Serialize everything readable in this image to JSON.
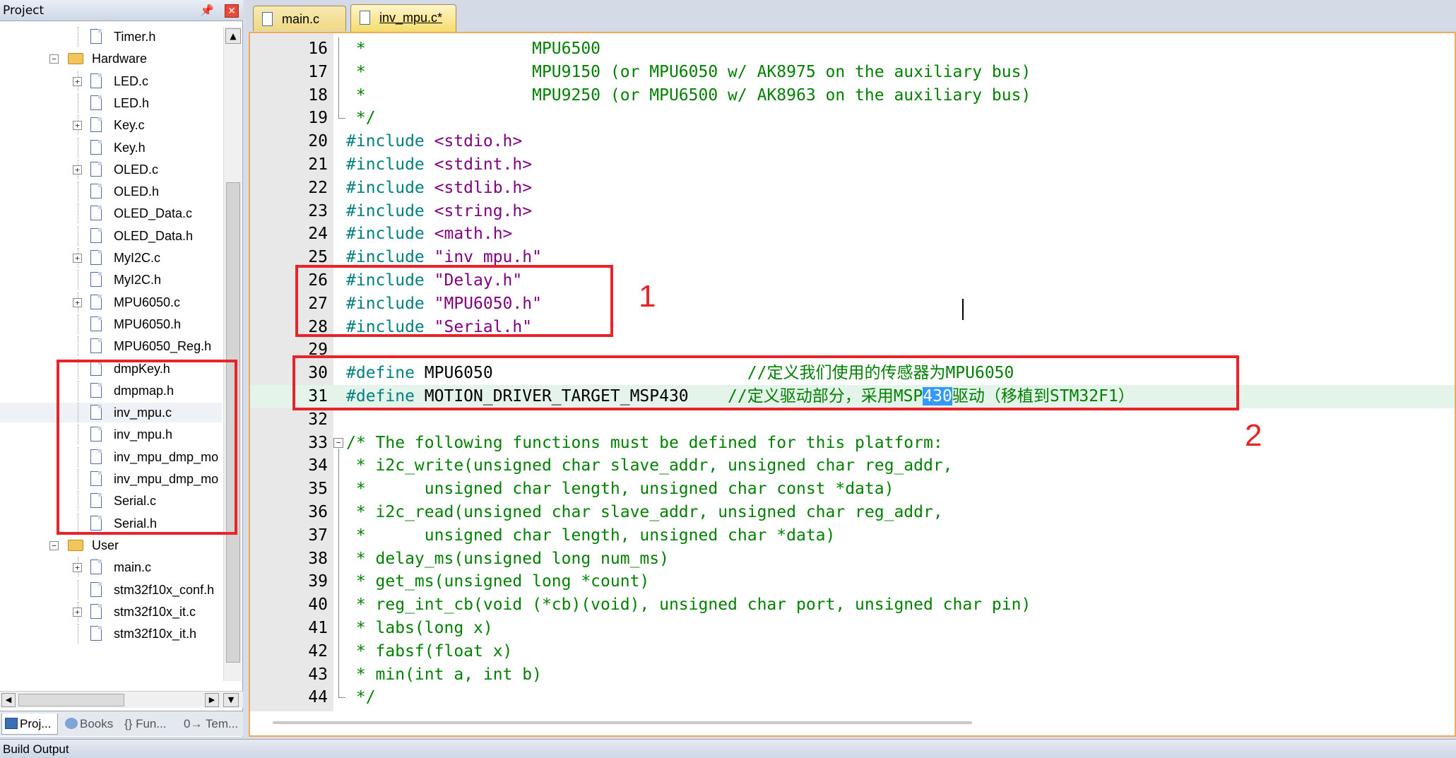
{
  "project_panel": {
    "title": "Project",
    "pin_glyph": "📌",
    "close_glyph": "✕",
    "tree": [
      {
        "label": "Timer.h",
        "kind": "file",
        "level": 2,
        "expander": ""
      },
      {
        "label": "Hardware",
        "kind": "folder",
        "level": 1,
        "expander": "−"
      },
      {
        "label": "LED.c",
        "kind": "file",
        "level": 2,
        "expander": "+"
      },
      {
        "label": "LED.h",
        "kind": "file",
        "level": 2,
        "expander": ""
      },
      {
        "label": "Key.c",
        "kind": "file",
        "level": 2,
        "expander": "+"
      },
      {
        "label": "Key.h",
        "kind": "file",
        "level": 2,
        "expander": ""
      },
      {
        "label": "OLED.c",
        "kind": "file",
        "level": 2,
        "expander": "+"
      },
      {
        "label": "OLED.h",
        "kind": "file",
        "level": 2,
        "expander": ""
      },
      {
        "label": "OLED_Data.c",
        "kind": "file",
        "level": 2,
        "expander": ""
      },
      {
        "label": "OLED_Data.h",
        "kind": "file",
        "level": 2,
        "expander": ""
      },
      {
        "label": "MyI2C.c",
        "kind": "file",
        "level": 2,
        "expander": "+"
      },
      {
        "label": "MyI2C.h",
        "kind": "file",
        "level": 2,
        "expander": ""
      },
      {
        "label": "MPU6050.c",
        "kind": "file",
        "level": 2,
        "expander": "+"
      },
      {
        "label": "MPU6050.h",
        "kind": "file",
        "level": 2,
        "expander": ""
      },
      {
        "label": "MPU6050_Reg.h",
        "kind": "file",
        "level": 2,
        "expander": ""
      },
      {
        "label": "dmpKey.h",
        "kind": "file",
        "level": 2,
        "expander": ""
      },
      {
        "label": "dmpmap.h",
        "kind": "file",
        "level": 2,
        "expander": ""
      },
      {
        "label": "inv_mpu.c",
        "kind": "file",
        "level": 2,
        "expander": "",
        "selected": true
      },
      {
        "label": "inv_mpu.h",
        "kind": "file",
        "level": 2,
        "expander": ""
      },
      {
        "label": "inv_mpu_dmp_mo",
        "kind": "file",
        "level": 2,
        "expander": ""
      },
      {
        "label": "inv_mpu_dmp_mo",
        "kind": "file",
        "level": 2,
        "expander": ""
      },
      {
        "label": "Serial.c",
        "kind": "file",
        "level": 2,
        "expander": ""
      },
      {
        "label": "Serial.h",
        "kind": "file",
        "level": 2,
        "expander": ""
      },
      {
        "label": "User",
        "kind": "folder",
        "level": 1,
        "expander": "−"
      },
      {
        "label": "main.c",
        "kind": "file",
        "level": 2,
        "expander": "+"
      },
      {
        "label": "stm32f10x_conf.h",
        "kind": "file",
        "level": 2,
        "expander": ""
      },
      {
        "label": "stm32f10x_it.c",
        "kind": "file",
        "level": 2,
        "expander": "+"
      },
      {
        "label": "stm32f10x_it.h",
        "kind": "file",
        "level": 2,
        "expander": ""
      }
    ],
    "scroll": {
      "up": "▲",
      "left": "◀",
      "right": "▶",
      "down": "▼"
    },
    "tabs": [
      {
        "label": "Proj...",
        "active": true,
        "icon": "project-icon"
      },
      {
        "label": "Books",
        "active": false,
        "icon": "books-icon"
      },
      {
        "label": "{} Fun...",
        "active": false,
        "icon": "functions-icon"
      },
      {
        "label": "0→ Tem...",
        "active": false,
        "icon": "templates-icon"
      }
    ]
  },
  "editor": {
    "tabs": [
      {
        "label": "main.c",
        "active": false
      },
      {
        "label": "inv_mpu.c*",
        "active": true
      }
    ],
    "lines": [
      {
        "n": "16",
        "fold": "line",
        "segs": [
          [
            "c",
            " *                 MPU6500"
          ]
        ]
      },
      {
        "n": "17",
        "fold": "line",
        "segs": [
          [
            "c",
            " *                 MPU9150 (or MPU6050 w/ AK8975 on the auxiliary bus)"
          ]
        ]
      },
      {
        "n": "18",
        "fold": "line",
        "segs": [
          [
            "c",
            " *                 MPU9250 (or MPU6500 w/ AK8963 on the auxiliary bus)"
          ]
        ]
      },
      {
        "n": "19",
        "fold": "end",
        "segs": [
          [
            "c",
            " */"
          ]
        ]
      },
      {
        "n": "20",
        "fold": "",
        "segs": [
          [
            "p",
            "#include "
          ],
          [
            "s",
            "<stdio.h>"
          ]
        ]
      },
      {
        "n": "21",
        "fold": "",
        "segs": [
          [
            "p",
            "#include "
          ],
          [
            "s",
            "<stdint.h>"
          ]
        ]
      },
      {
        "n": "22",
        "fold": "",
        "segs": [
          [
            "p",
            "#include "
          ],
          [
            "s",
            "<stdlib.h>"
          ]
        ]
      },
      {
        "n": "23",
        "fold": "",
        "segs": [
          [
            "p",
            "#include "
          ],
          [
            "s",
            "<string.h>"
          ]
        ]
      },
      {
        "n": "24",
        "fold": "",
        "segs": [
          [
            "p",
            "#include "
          ],
          [
            "s",
            "<math.h>"
          ]
        ]
      },
      {
        "n": "25",
        "fold": "",
        "segs": [
          [
            "p",
            "#include "
          ],
          [
            "s",
            "\"inv_mpu.h\""
          ]
        ]
      },
      {
        "n": "26",
        "fold": "",
        "segs": [
          [
            "p",
            "#include "
          ],
          [
            "s",
            "\"Delay.h\""
          ]
        ]
      },
      {
        "n": "27",
        "fold": "",
        "segs": [
          [
            "p",
            "#include "
          ],
          [
            "s",
            "\"MPU6050.h\""
          ]
        ]
      },
      {
        "n": "28",
        "fold": "",
        "segs": [
          [
            "p",
            "#include "
          ],
          [
            "s",
            "\"Serial.h\""
          ]
        ]
      },
      {
        "n": "29",
        "fold": "",
        "segs": []
      },
      {
        "n": "30",
        "fold": "",
        "segs": [
          [
            "p",
            "#define "
          ],
          [
            "t",
            "MPU6050                          "
          ],
          [
            "c",
            "//定义我们使用的传感器为MPU6050"
          ]
        ]
      },
      {
        "n": "31",
        "fold": "",
        "current": true,
        "segs": [
          [
            "p",
            "#define "
          ],
          [
            "t",
            "MOTION_DRIVER_TARGET_MSP430    "
          ],
          [
            "c",
            "//定义驱动部分，采用MSP"
          ],
          [
            "sel",
            "430"
          ],
          [
            "c",
            "驱动（移植到STM32F1）"
          ]
        ]
      },
      {
        "n": "32",
        "fold": "",
        "segs": []
      },
      {
        "n": "33",
        "fold": "box",
        "segs": [
          [
            "c",
            "/* The following functions must be defined for this platform:"
          ]
        ]
      },
      {
        "n": "34",
        "fold": "line",
        "segs": [
          [
            "c",
            " * i2c_write(unsigned char slave_addr, unsigned char reg_addr,"
          ]
        ]
      },
      {
        "n": "35",
        "fold": "line",
        "segs": [
          [
            "c",
            " *      unsigned char length, unsigned char const *data)"
          ]
        ]
      },
      {
        "n": "36",
        "fold": "line",
        "segs": [
          [
            "c",
            " * i2c_read(unsigned char slave_addr, unsigned char reg_addr,"
          ]
        ]
      },
      {
        "n": "37",
        "fold": "line",
        "segs": [
          [
            "c",
            " *      unsigned char length, unsigned char *data)"
          ]
        ]
      },
      {
        "n": "38",
        "fold": "line",
        "segs": [
          [
            "c",
            " * delay_ms(unsigned long num_ms)"
          ]
        ]
      },
      {
        "n": "39",
        "fold": "line",
        "segs": [
          [
            "c",
            " * get_ms(unsigned long *count)"
          ]
        ]
      },
      {
        "n": "40",
        "fold": "line",
        "segs": [
          [
            "c",
            " * reg_int_cb(void (*cb)(void), unsigned char port, unsigned char pin)"
          ]
        ]
      },
      {
        "n": "41",
        "fold": "line",
        "segs": [
          [
            "c",
            " * labs(long x)"
          ]
        ]
      },
      {
        "n": "42",
        "fold": "line",
        "segs": [
          [
            "c",
            " * fabsf(float x)"
          ]
        ]
      },
      {
        "n": "43",
        "fold": "line",
        "segs": [
          [
            "c",
            " * min(int a, int b)"
          ]
        ]
      },
      {
        "n": "44",
        "fold": "end",
        "segs": [
          [
            "c",
            " */"
          ]
        ]
      }
    ]
  },
  "annotations": {
    "label_1": "1",
    "label_2": "2"
  },
  "build_output": {
    "title": "Build Output"
  },
  "colors": {
    "comment": "#008000",
    "preprocessor": "#008080",
    "string": "#800080",
    "annotation": "#e8232a",
    "selection": "#3399ff",
    "current_line": "#e4f4ea",
    "editor_border": "#f0a95a"
  }
}
